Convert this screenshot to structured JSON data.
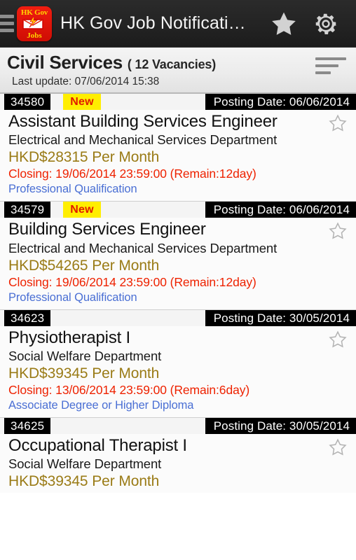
{
  "actionbar": {
    "app_title": "HK Gov Job Notificati…",
    "logo_line1": "HK Gov",
    "logo_line2": "Jobs",
    "menu_icon": "hamburger-icon",
    "favorites_icon": "star-filled-icon",
    "settings_icon": "gear-icon"
  },
  "section": {
    "title": "Civil Services",
    "vacancies": "( 12 Vacancies)",
    "last_update_label": "Last update:",
    "last_update_value": "07/06/2014 15:38",
    "last_update_full": "Last update:  07/06/2014 15:38",
    "sort_icon": "sort-icon"
  },
  "labels": {
    "posting_date_prefix": "Posting Date:",
    "new_badge": "New"
  },
  "colors": {
    "actionbar_bg": "#232323",
    "logo_red": "#e61407",
    "logo_yellow": "#ffd400",
    "badge_yellow": "#ffee00",
    "badge_red_text": "#e01b00",
    "salary": "#9a7b16",
    "closing": "#ee2200",
    "qualification": "#4a6fd4",
    "band_black": "#000000",
    "card_bg": "#fbfbfb",
    "header_bg": "#ececec"
  },
  "jobs": [
    {
      "id": "34580",
      "is_new": true,
      "posting_date": "06/06/2014",
      "posting_date_full": "Posting Date:  06/06/2014",
      "title": "Assistant Building Services Engineer",
      "department": "Electrical and Mechanical Services Department",
      "salary": "HKD$28315 Per Month",
      "closing": "Closing: 19/06/2014 23:59:00 (Remain:12day)",
      "qualification": "Professional Qualification",
      "favorited": false
    },
    {
      "id": "34579",
      "is_new": true,
      "posting_date": "06/06/2014",
      "posting_date_full": "Posting Date:  06/06/2014",
      "title": "Building Services Engineer",
      "department": "Electrical and Mechanical Services Department",
      "salary": "HKD$54265 Per Month",
      "closing": "Closing: 19/06/2014 23:59:00 (Remain:12day)",
      "qualification": "Professional Qualification",
      "favorited": false
    },
    {
      "id": "34623",
      "is_new": false,
      "posting_date": "30/05/2014",
      "posting_date_full": "Posting Date:  30/05/2014",
      "title": "Physiotherapist I",
      "department": "Social Welfare Department",
      "salary": "HKD$39345 Per Month",
      "closing": "Closing: 13/06/2014 23:59:00 (Remain:6day)",
      "qualification": "Associate Degree or Higher Diploma",
      "favorited": false
    },
    {
      "id": "34625",
      "is_new": false,
      "posting_date": "30/05/2014",
      "posting_date_full": "Posting Date:  30/05/2014",
      "title": "Occupational Therapist I",
      "department": "Social Welfare Department",
      "salary": "HKD$39345 Per Month",
      "closing": "",
      "qualification": "",
      "favorited": false
    }
  ]
}
